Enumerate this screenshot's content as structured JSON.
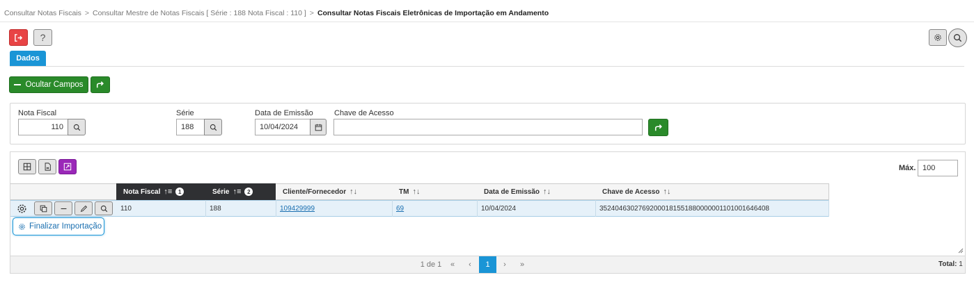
{
  "breadcrumb": {
    "item1": "Consultar Notas Fiscais",
    "item2": "Consultar Mestre de Notas Fiscais [ Série : 188 Nota Fiscal : 110 ]",
    "current": "Consultar Notas Fiscais Eletrônicas de Importação em Andamento",
    "separator": ">"
  },
  "toolbar": {
    "help_label": "?",
    "exit_icon": "exit-icon",
    "settings_icon": "gear-icon",
    "search_icon": "search-icon"
  },
  "tabs": {
    "dados": "Dados"
  },
  "actions": {
    "hide_fields": "Ocultar Campos"
  },
  "filters": {
    "nota_fiscal_label": "Nota Fiscal",
    "nota_fiscal_value": "110",
    "serie_label": "Série",
    "serie_value": "188",
    "data_emissao_label": "Data de Emissão",
    "data_emissao_value": "10/04/2024",
    "chave_label": "Chave de Acesso",
    "chave_value": ""
  },
  "grid": {
    "max_label": "Máx.",
    "max_value": "100",
    "columns": [
      {
        "label": "Nota Fiscal",
        "badge": "1"
      },
      {
        "label": "Série",
        "badge": "2"
      },
      {
        "label": "Cliente/Fornecedor"
      },
      {
        "label": "TM"
      },
      {
        "label": "Data de Emissão"
      },
      {
        "label": "Chave de Acesso"
      }
    ],
    "rows": [
      {
        "nota_fiscal": "110",
        "serie": "188",
        "cliente": "109429999",
        "tm": "69",
        "data_emissao": "10/04/2024",
        "chave": "35240463027692000181551880000001101001646408"
      }
    ],
    "row_menu": {
      "finalize": "Finalizar Importação"
    }
  },
  "pagination": {
    "page_info": "1 de 1",
    "first": "«",
    "prev": "‹",
    "current": "1",
    "next": "›",
    "last": "»",
    "total_label": "Total:",
    "total_value": "1"
  },
  "colors": {
    "accent": "#1a95d6",
    "success": "#2a8a2a",
    "danger": "#e84445",
    "purple": "#9a28b8",
    "header_dark": "#2f3033"
  }
}
